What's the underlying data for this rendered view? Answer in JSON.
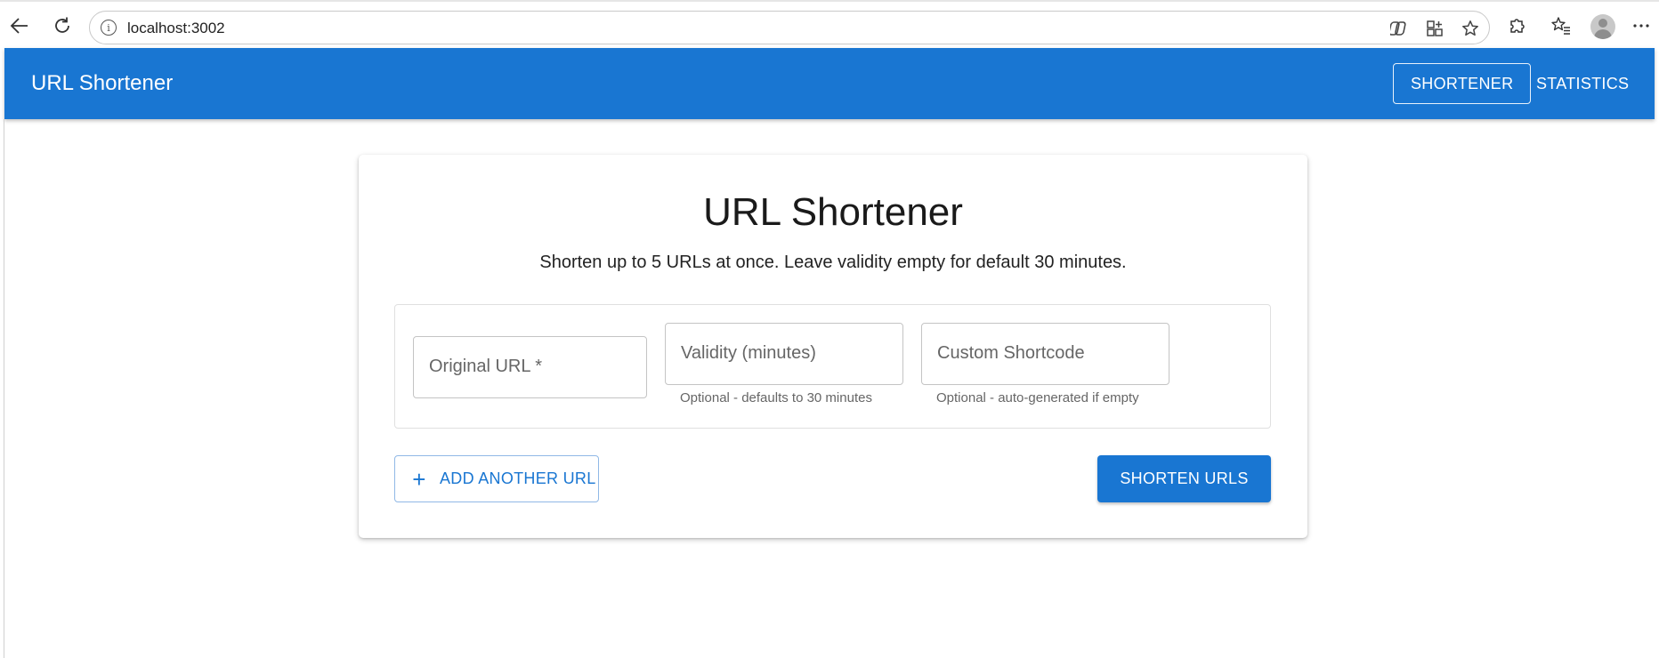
{
  "browser": {
    "url": "localhost:3002",
    "icons": [
      "back-icon",
      "reload-icon",
      "site-info-icon",
      "copilot-icon",
      "split-screen-icon",
      "favorite-star-icon",
      "extensions-icon",
      "favorites-icon",
      "profile-avatar",
      "more-icon"
    ]
  },
  "appbar": {
    "title": "URL Shortener",
    "nav": [
      {
        "label": "SHORTENER",
        "active": true
      },
      {
        "label": "STATISTICS",
        "active": false
      }
    ],
    "color": "#1976d2"
  },
  "main": {
    "title": "URL Shortener",
    "subtitle": "Shorten up to 5 URLs at once. Leave validity empty for default 30 minutes.",
    "fields": {
      "original_url": {
        "label": "Original URL *",
        "value": ""
      },
      "validity": {
        "label": "Validity (minutes)",
        "value": "",
        "helper": "Optional - defaults to 30 minutes"
      },
      "shortcode": {
        "label": "Custom Shortcode",
        "value": "",
        "helper": "Optional - auto-generated if empty"
      }
    },
    "add_button": "ADD ANOTHER URL",
    "submit_button": "SHORTEN URLS"
  }
}
